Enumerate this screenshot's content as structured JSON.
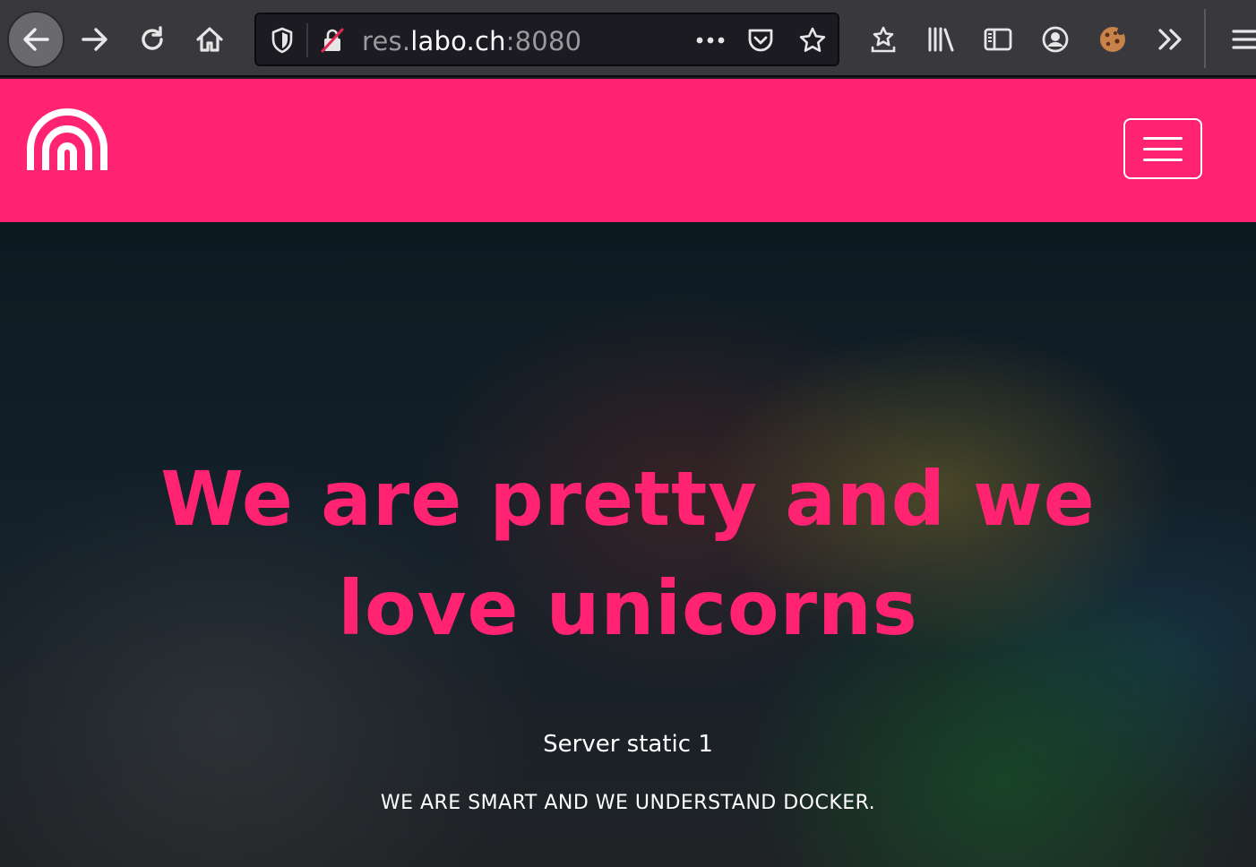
{
  "browser": {
    "url_scheme_prefix": "res.",
    "url_host": "labo.ch",
    "url_suffix": ":8080",
    "toolbar_icons": [
      "back-icon",
      "forward-icon",
      "reload-icon",
      "home-icon",
      "tracking-shield-icon",
      "insecure-lock-icon",
      "page-actions-icon",
      "pocket-icon",
      "bookmark-star-icon",
      "downloads-icon",
      "library-icon",
      "sidebar-icon",
      "account-icon",
      "cookie-extension-icon",
      "overflow-icon",
      "app-menu-icon"
    ]
  },
  "site": {
    "brand_color": "#ff2372",
    "logo_icon": "rainbow-arch-logo",
    "navbar_toggle_icon": "hamburger-icon",
    "hero": {
      "title": "We are pretty and we love unicorns",
      "subtitle": "Server static 1",
      "tagline": "WE ARE SMART AND WE UNDERSTAND DOCKER."
    }
  }
}
